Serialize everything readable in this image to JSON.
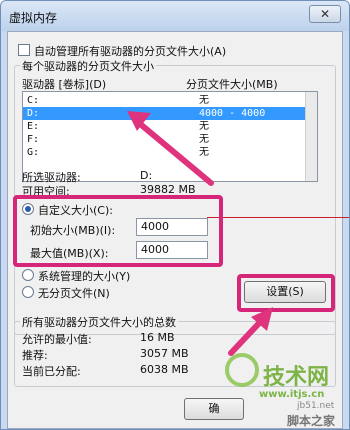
{
  "window": {
    "title": "虚拟内存",
    "close_label": "✕"
  },
  "auto_manage": {
    "label": "自动管理所有驱动器的分页文件大小(A)",
    "checked": false
  },
  "per_drive_group": {
    "title": "每个驱动器的分页文件大小",
    "col_drive": "驱动器 [卷标](D)",
    "col_size": "分页文件大小(MB)",
    "rows": [
      {
        "drive": "C:",
        "size": "无",
        "selected": false
      },
      {
        "drive": "D:",
        "size": "4000 - 4000",
        "selected": true
      },
      {
        "drive": "E:",
        "size": "无",
        "selected": false
      },
      {
        "drive": "F:",
        "size": "无",
        "selected": false
      },
      {
        "drive": "G:",
        "size": "无",
        "selected": false
      }
    ],
    "selected_drive_label": "所选驱动器:",
    "selected_drive_value": "D:",
    "free_space_label": "可用空间:",
    "free_space_value": "39882 MB",
    "custom_size_label": "自定义大小(C):",
    "initial_size_label": "初始大小(MB)(I):",
    "initial_size_value": "4000",
    "max_size_label": "最大值(MB)(X):",
    "max_size_value": "4000",
    "system_managed_label": "系统管理的大小(Y)",
    "no_paging_label": "无分页文件(N)",
    "set_button_label": "设置(S)",
    "size_option": "custom"
  },
  "totals_group": {
    "title": "所有驱动器分页文件大小的总数",
    "min_allowed_label": "允许的最小值:",
    "min_allowed_value": "16 MB",
    "recommended_label": "推荐:",
    "recommended_value": "3057 MB",
    "current_label": "当前已分配:",
    "current_value": "6038 MB"
  },
  "ok_button_label": "确",
  "watermark": {
    "brand": "技术网",
    "url": "www.itjs.cn",
    "site": "jb51.net",
    "site2": "脚本之家"
  },
  "colors": {
    "highlight": "#d6267a",
    "arrow": "#e0337e",
    "selection": "#3399ff"
  }
}
